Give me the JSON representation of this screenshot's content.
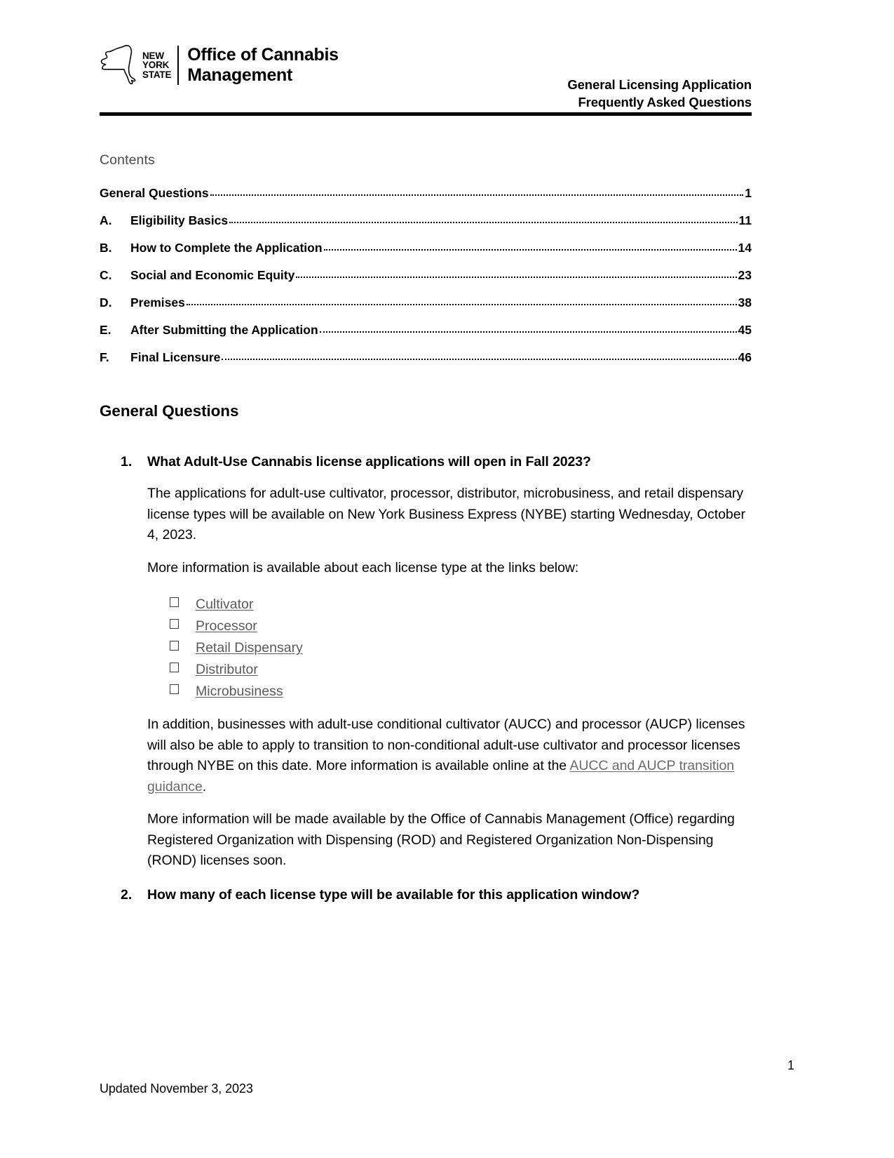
{
  "header": {
    "logo": {
      "state_line1": "NEW",
      "state_line2": "YORK",
      "state_line3": "STATE",
      "agency_line1": "Office of Cannabis",
      "agency_line2": "Management",
      "icon_name": "new-york-state-outline-icon"
    },
    "doc_title_line1": "General Licensing Application",
    "doc_title_line2": "Frequently Asked Questions"
  },
  "contents": {
    "heading": "Contents",
    "entries": [
      {
        "letter": "",
        "label": "General Questions",
        "page": "1"
      },
      {
        "letter": "A.",
        "label": "Eligibility Basics",
        "page": "11"
      },
      {
        "letter": "B.",
        "label": "How to Complete the Application",
        "page": "14"
      },
      {
        "letter": "C.",
        "label": "Social and Economic Equity",
        "page": "23"
      },
      {
        "letter": "D.",
        "label": "Premises",
        "page": "38"
      },
      {
        "letter": "E.",
        "label": "After Submitting the Application",
        "page": "45"
      },
      {
        "letter": "F.",
        "label": "Final Licensure",
        "page": "46"
      }
    ]
  },
  "main": {
    "section_title": "General Questions",
    "q1": {
      "number": "1.",
      "question": "What Adult-Use Cannabis license applications will open in Fall 2023?",
      "para1": "The applications for adult-use cultivator, processor, distributor, microbusiness, and retail dispensary license types will be available on New York Business Express (NYBE) starting Wednesday, October 4, 2023.",
      "para2": "More information is available about each license type at the links below:",
      "links": [
        "Cultivator",
        "Processor",
        "Retail Dispensary",
        "Distributor",
        "Microbusiness"
      ],
      "para3_before": "In addition, businesses with adult-use conditional cultivator (AUCC) and processor (AUCP) licenses will also be able to apply to transition to non-conditional adult-use cultivator and processor licenses through NYBE on this date. More information is available online at the ",
      "para3_link": "AUCC and AUCP transition guidance",
      "para3_after": ".",
      "para4": "More information will be made available by the Office of Cannabis Management (Office) regarding Registered Organization with Dispensing (ROD) and Registered Organization Non-Dispensing (ROND) licenses soon."
    },
    "q2": {
      "number": "2.",
      "question": "How many of each license type will be available for this application window?"
    }
  },
  "footer": {
    "page_number": "1",
    "updated": "Updated November 3, 2023"
  },
  "colors": {
    "text": "#000000",
    "contents_heading": "#4a4a4a",
    "link": "#5a5a5a",
    "rule": "#000000"
  }
}
